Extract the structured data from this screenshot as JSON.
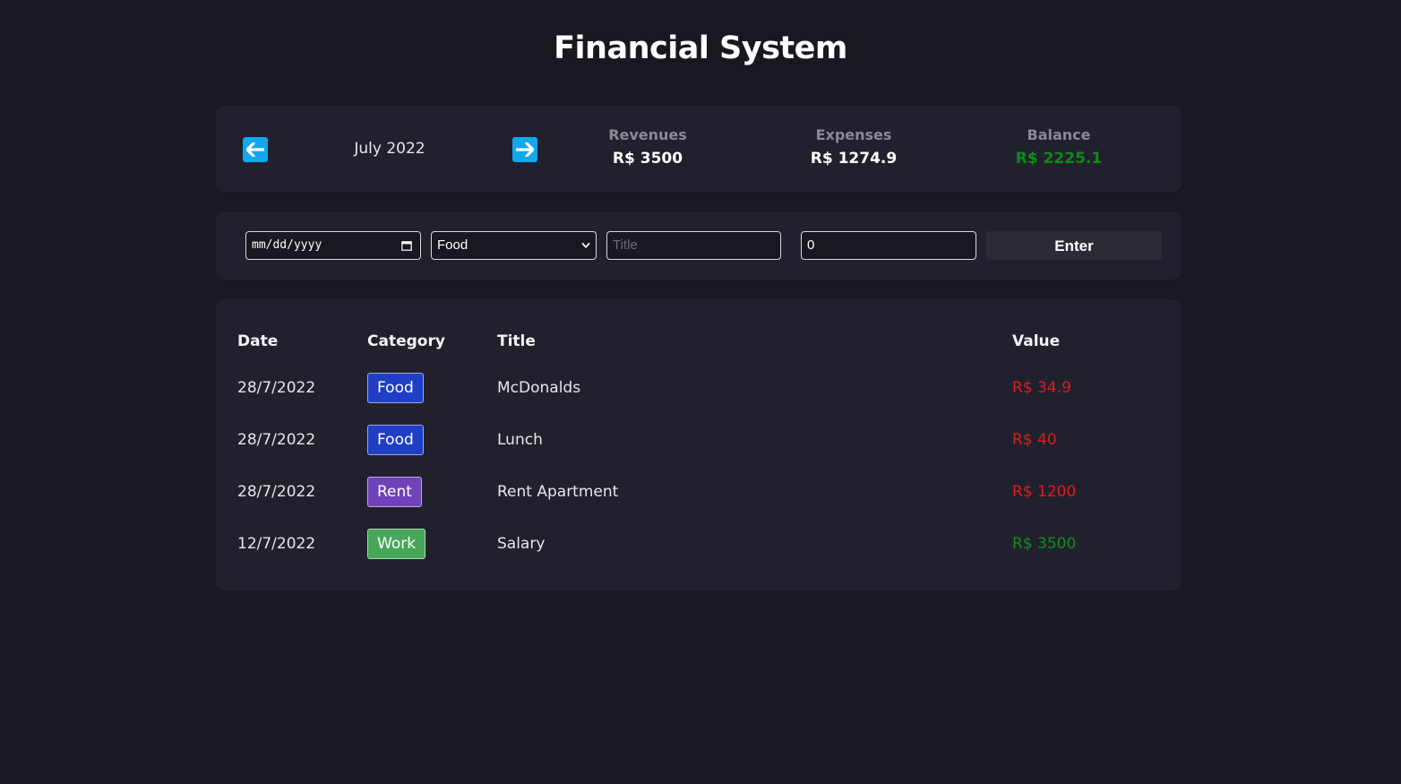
{
  "header": {
    "title": "Financial System"
  },
  "summary": {
    "month": "July 2022",
    "revenues_label": "Revenues",
    "revenues_value": "R$ 3500",
    "expenses_label": "Expenses",
    "expenses_value": "R$ 1274.9",
    "balance_label": "Balance",
    "balance_value": "R$ 2225.1",
    "balance_color": "#0e8a16",
    "arrow_color": "#12a7ee",
    "prev_icon": "arrow-left-icon",
    "next_icon": "arrow-right-icon"
  },
  "form": {
    "date_placeholder": "mm/dd/yyyy",
    "category_selected": "Food",
    "title_placeholder": "Title",
    "value": "0",
    "submit_label": "Enter"
  },
  "table": {
    "headers": {
      "date": "Date",
      "category": "Category",
      "title": "Title",
      "value": "Value"
    },
    "rows": [
      {
        "date": "28/7/2022",
        "category": "Food",
        "category_color": "#1f3ec4",
        "title": "McDonalds",
        "value": "R$ 34.9",
        "type": "expense"
      },
      {
        "date": "28/7/2022",
        "category": "Food",
        "category_color": "#1f3ec4",
        "title": "Lunch",
        "value": "R$ 40",
        "type": "expense"
      },
      {
        "date": "28/7/2022",
        "category": "Rent",
        "category_color": "#7042b9",
        "title": "Rent Apartment",
        "value": "R$ 1200",
        "type": "expense"
      },
      {
        "date": "12/7/2022",
        "category": "Work",
        "category_color": "#45a757",
        "title": "Salary",
        "value": "R$ 3500",
        "type": "revenue"
      }
    ],
    "expense_color": "#e01b1b",
    "revenue_color": "#178a1f"
  }
}
